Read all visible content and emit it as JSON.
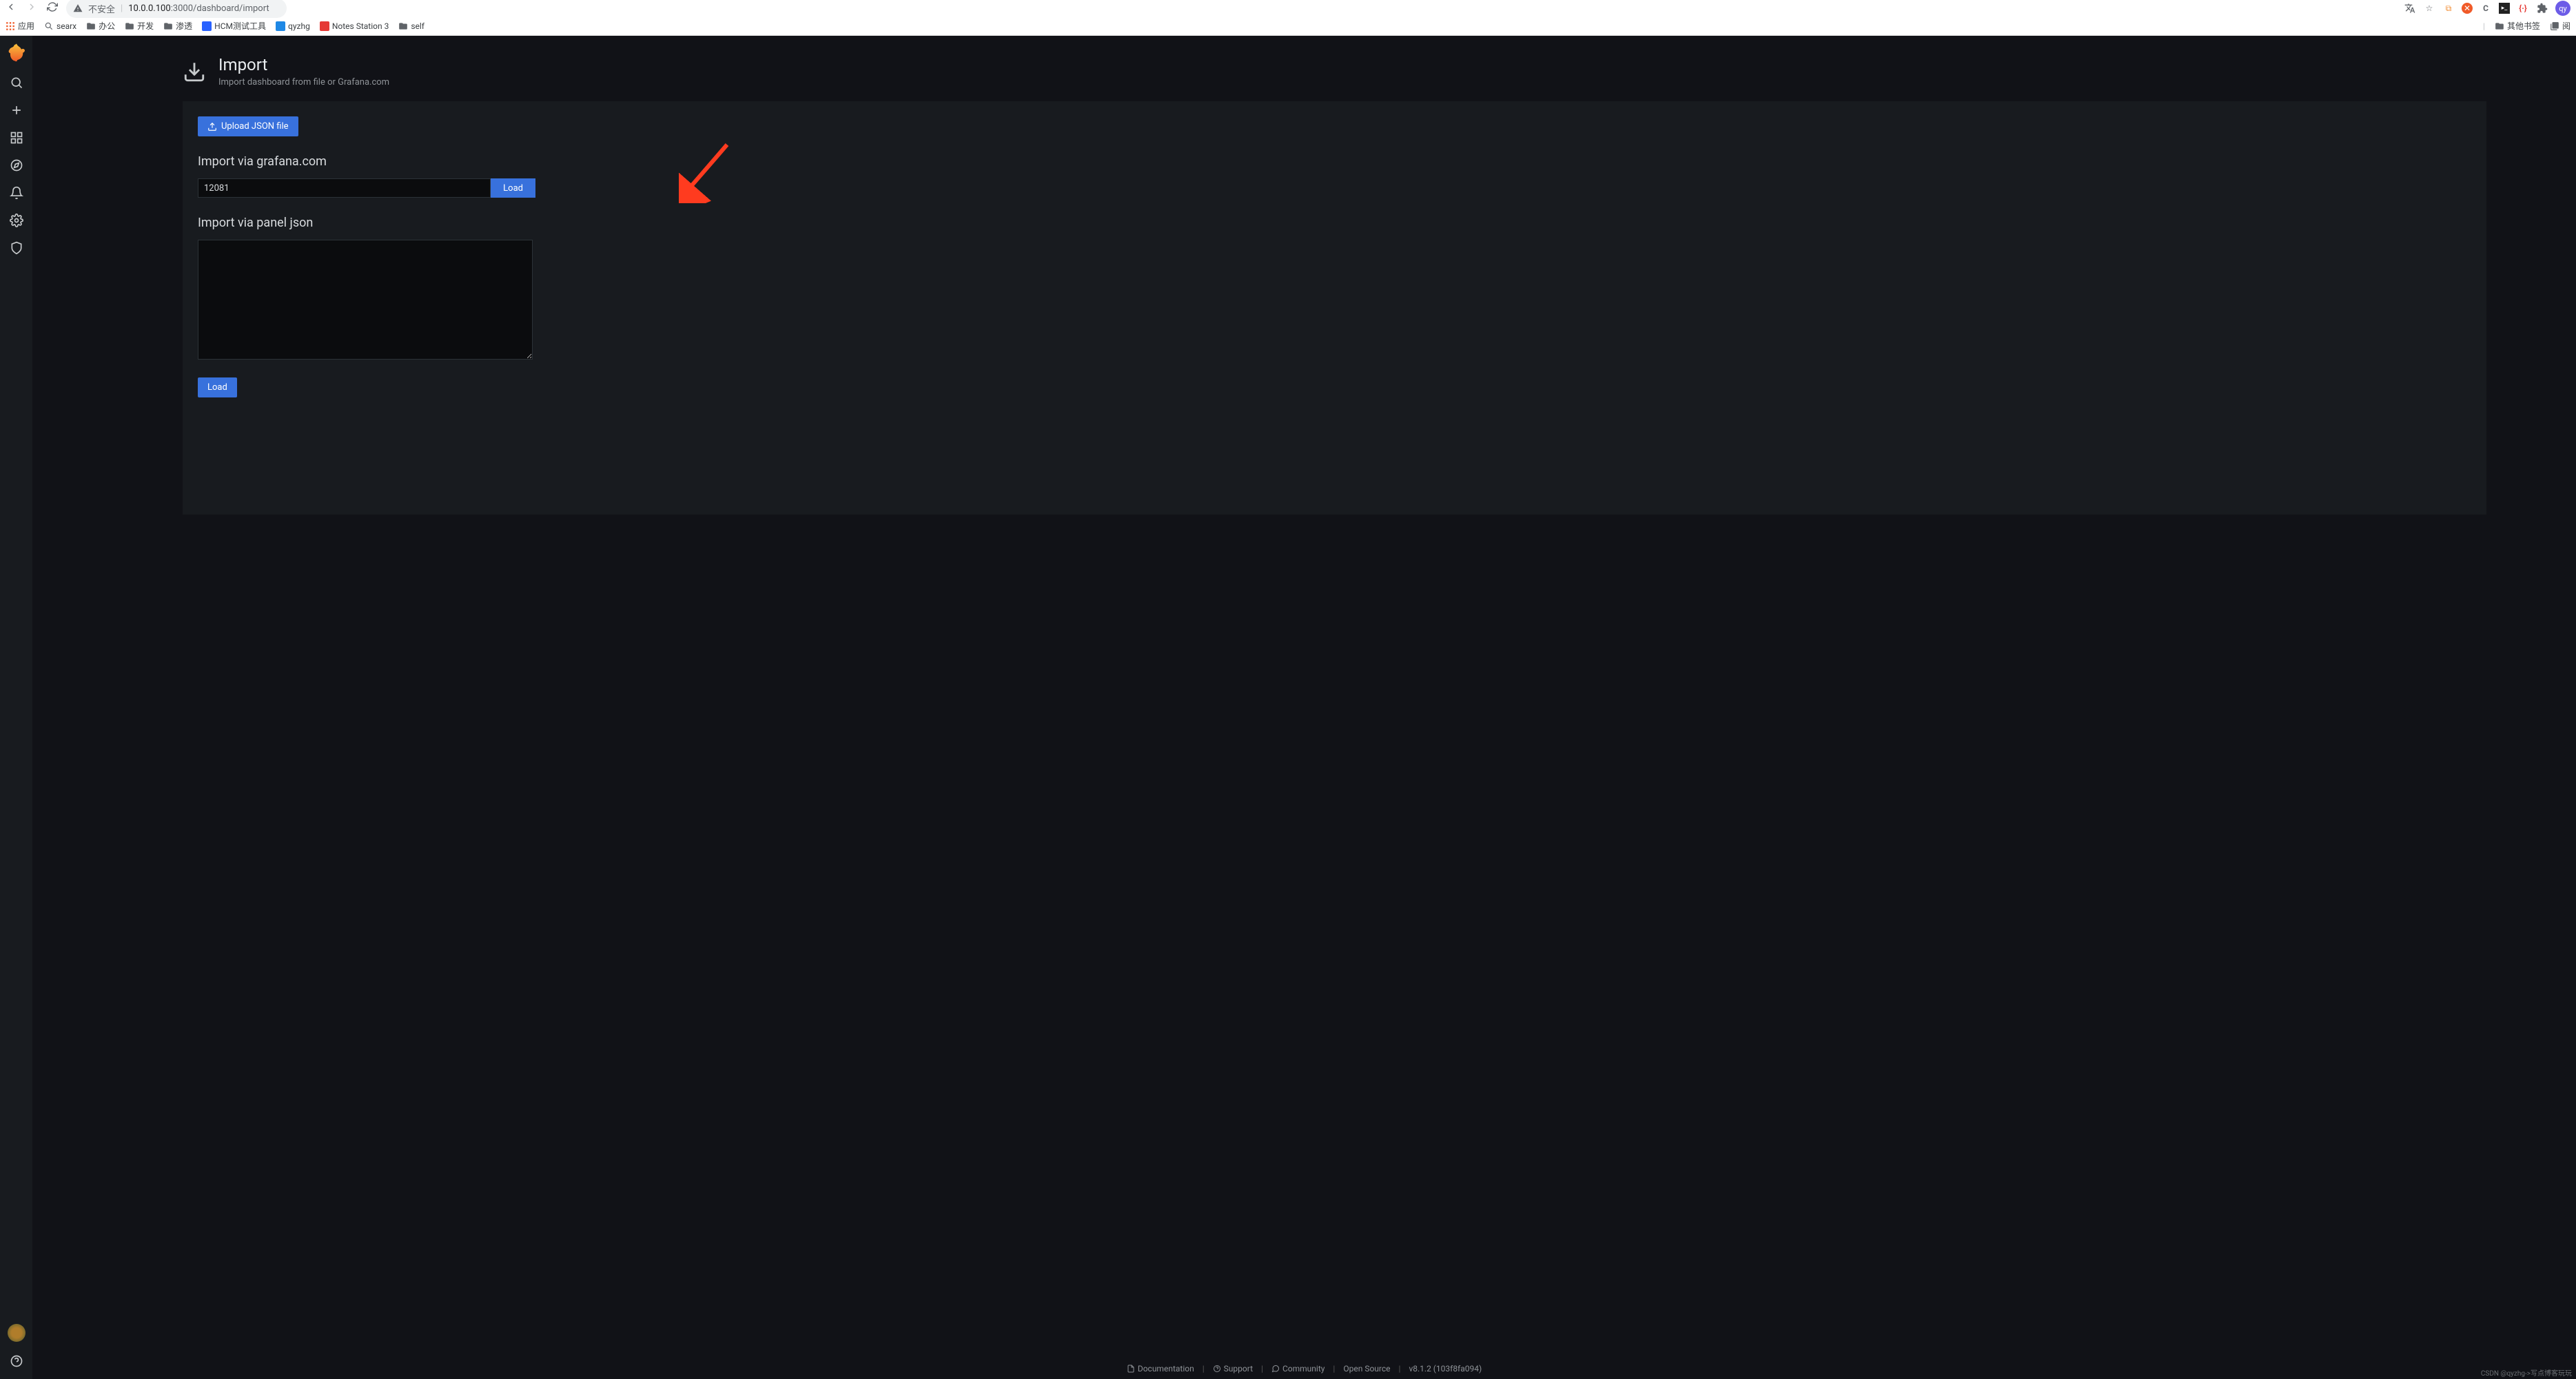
{
  "browser": {
    "insecure_label": "不安全",
    "url_host": "10.0.0.100",
    "url_port_path": ":3000/dashboard/import",
    "avatar_initial": "qy"
  },
  "bookmarks": {
    "apps": "应用",
    "items": [
      "searx",
      "办公",
      "开发",
      "渗透",
      "HCM测试工具",
      "qyzhg",
      "Notes Station 3",
      "self"
    ],
    "other": "其他书签",
    "read": "阅"
  },
  "page": {
    "title": "Import",
    "subtitle": "Import dashboard from file or Grafana.com"
  },
  "upload_btn": "Upload JSON file",
  "section_gcom": "Import via grafana.com",
  "gcom_value": "12081",
  "load_btn": "Load",
  "section_json": "Import via panel json",
  "json_value": "",
  "load_btn2": "Load",
  "footer": {
    "doc": "Documentation",
    "support": "Support",
    "community": "Community",
    "opensource": "Open Source",
    "version": "v8.1.2 (103f8fa094)"
  },
  "watermark": "CSDN @qyzhg->写点博客玩玩"
}
